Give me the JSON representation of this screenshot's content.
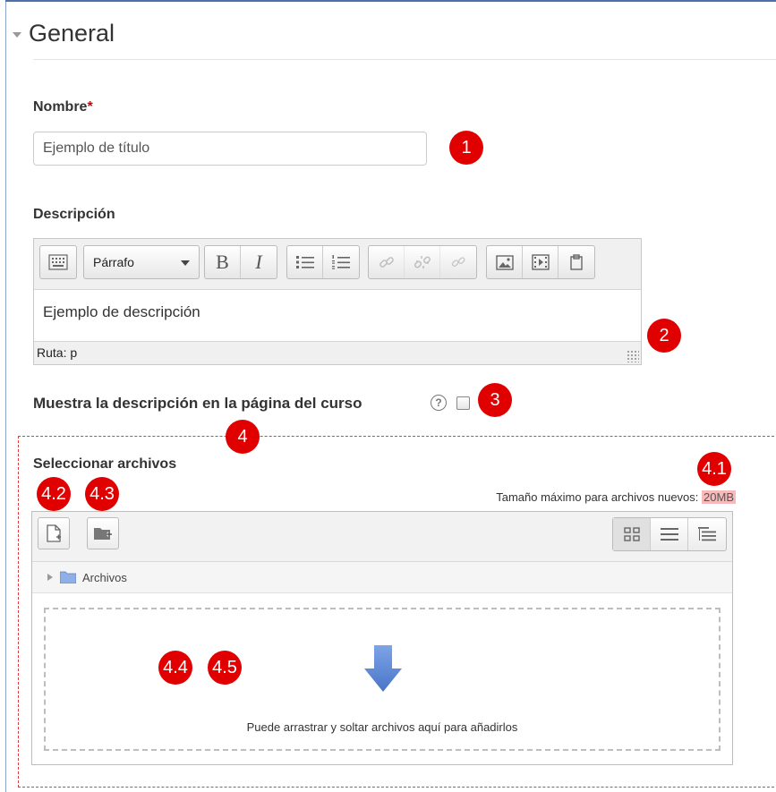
{
  "section": {
    "title": "General"
  },
  "name_field": {
    "label": "Nombre",
    "required_mark": "*",
    "value": "Ejemplo de título"
  },
  "description": {
    "label": "Descripción",
    "format_select": "Párrafo",
    "toolbar_icons": [
      "toolbar-toggle-icon",
      "bold-icon",
      "italic-icon",
      "unordered-list-icon",
      "ordered-list-icon",
      "link-icon",
      "unlink-icon",
      "anchor-icon",
      "image-icon",
      "media-icon",
      "paste-icon"
    ],
    "bold_glyph": "B",
    "italic_glyph": "I",
    "content": "Ejemplo de descripción",
    "status_path": "Ruta: p"
  },
  "show_description": {
    "label": "Muestra la descripción en la página del curso",
    "help_glyph": "?",
    "checked": false
  },
  "files": {
    "label": "Seleccionar archivos",
    "max_size_label": "Tamaño máximo para archivos nuevos:",
    "max_size_value": "20MB",
    "folder_name": "Archivos",
    "drop_text": "Puede arrastrar y soltar archivos aquí para añadirlos"
  },
  "markers": [
    "1",
    "2",
    "3",
    "4",
    "4.1",
    "4.2",
    "4.3",
    "4.4",
    "4.5"
  ],
  "colors": {
    "marker": "#e00000",
    "dashed_border": "#e33c3c",
    "max_size_highlight": "#f7b9b9",
    "drop_arrow": "#5b86d6",
    "folder": "#8fb0e6"
  }
}
